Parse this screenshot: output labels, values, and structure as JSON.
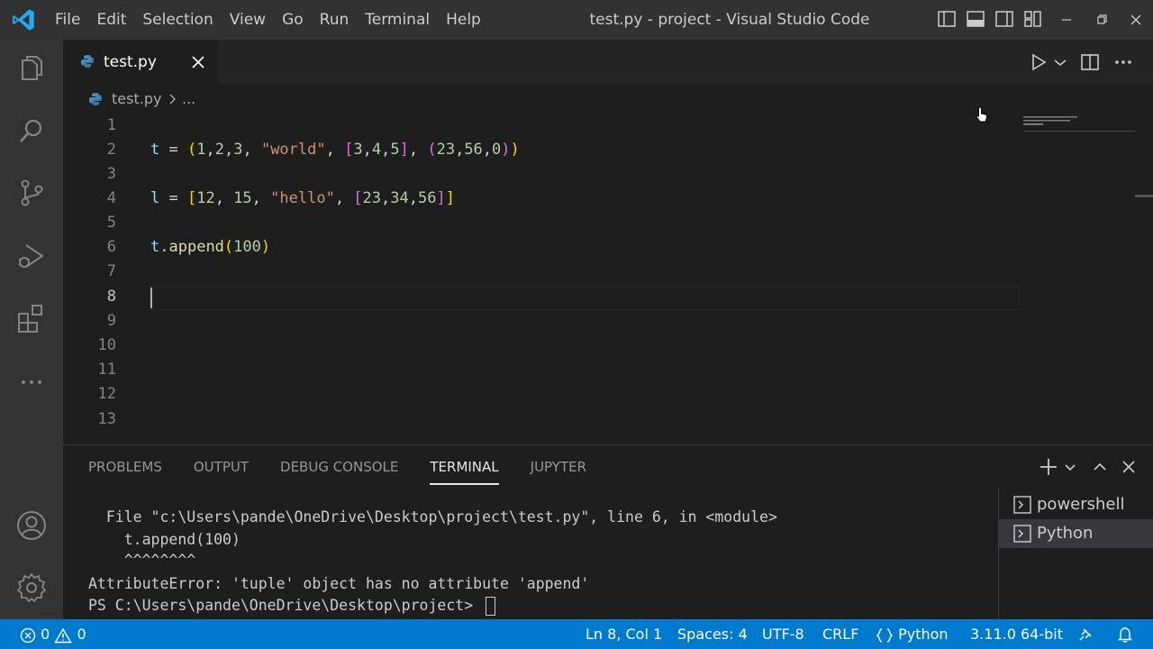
{
  "window": {
    "title": "test.py - project - Visual Studio Code",
    "menu": [
      "File",
      "Edit",
      "Selection",
      "View",
      "Go",
      "Run",
      "Terminal",
      "Help"
    ]
  },
  "tab": {
    "label": "test.py"
  },
  "breadcrumb": {
    "file": "test.py",
    "more": "..."
  },
  "editor": {
    "line_numbers": [
      "1",
      "2",
      "3",
      "4",
      "5",
      "6",
      "7",
      "8",
      "9",
      "10",
      "11",
      "12",
      "13"
    ],
    "current_line": 8,
    "lines": {
      "l2": {
        "t": "t",
        "eq": " = ",
        "p_open": "(",
        "n1": "1",
        "c1": ",",
        "n2": "2",
        "c2": ",",
        "n3": "3",
        "c3": ", ",
        "s1": "\"world\"",
        "c4": ", ",
        "b_open": "[",
        "n4": "3",
        "c5": ",",
        "n5": "4",
        "c6": ",",
        "n6": "5",
        "b_close": "]",
        "c7": ", ",
        "p2_open": "(",
        "n7": "23",
        "c8": ",",
        "n8": "56",
        "c9": ",",
        "n9": "0",
        "p2_close": ")",
        "p_close": ")"
      },
      "l4": {
        "l": "l",
        "eq": " = ",
        "b_open": "[",
        "n1": "12",
        "c1": ", ",
        "n2": "15",
        "c2": ", ",
        "s1": "\"hello\"",
        "c3": ", ",
        "b2_open": "[",
        "n3": "23",
        "c4": ",",
        "n4": "34",
        "c5": ",",
        "n5": "56",
        "b2_close": "]",
        "b_close": "]"
      },
      "l6": {
        "t": "t",
        "dot": ".",
        "fn": "append",
        "p_open": "(",
        "n1": "100",
        "p_close": ")"
      }
    }
  },
  "panel": {
    "tabs": [
      "PROBLEMS",
      "OUTPUT",
      "DEBUG CONSOLE",
      "TERMINAL",
      "JUPYTER"
    ],
    "active_tab": "TERMINAL",
    "terminal_lines": [
      "  File \"c:\\Users\\pande\\OneDrive\\Desktop\\project\\test.py\", line 6, in <module>",
      "    t.append(100)",
      "    ^^^^^^^^",
      "AttributeError: 'tuple' object has no attribute 'append'",
      "PS C:\\Users\\pande\\OneDrive\\Desktop\\project> "
    ],
    "terminals": [
      "powershell",
      "Python"
    ],
    "selected_terminal": "Python"
  },
  "statusbar": {
    "errors": "0",
    "warnings": "0",
    "position": "Ln 8, Col 1",
    "spaces": "Spaces: 4",
    "encoding": "UTF-8",
    "eol": "CRLF",
    "language": "Python",
    "interpreter": "3.11.0 64-bit"
  },
  "colors": {
    "accent": "#007acc",
    "titlebar": "#323233",
    "activitybar": "#333333",
    "editor_bg": "#1e1e1e",
    "string": "#ce9178",
    "number": "#b5cea8",
    "variable": "#9cdcfe",
    "function": "#dcdcaa",
    "bracket_gold": "#ffd700",
    "bracket_orchid": "#da70d6"
  }
}
